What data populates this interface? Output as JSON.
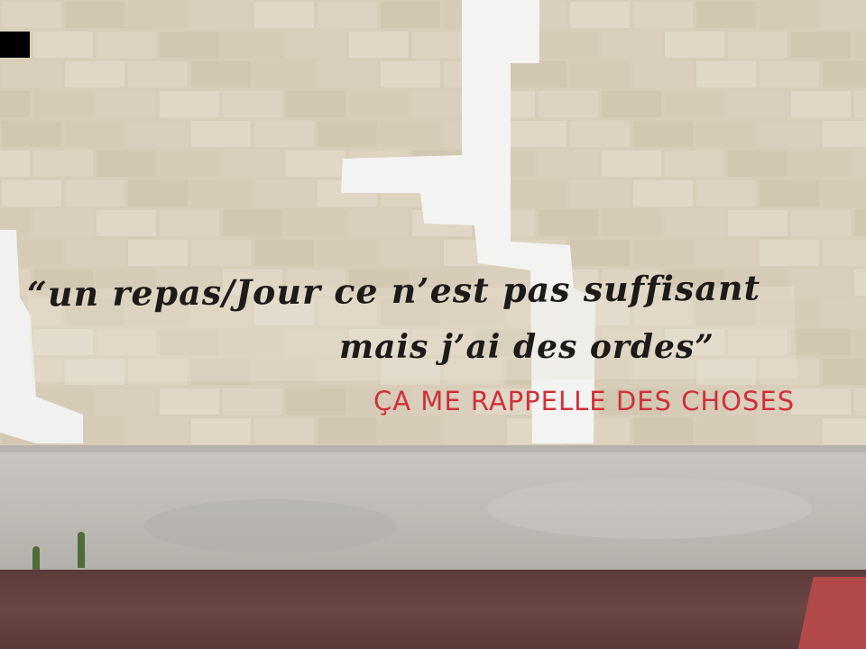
{
  "graffiti": {
    "line1": "“un repas/Jour ce n’est pas suffisant",
    "line2": "mais j’ai des ordes”",
    "line3": "ÇA ME RAPPELLE DES CHOSES"
  },
  "colors": {
    "wall": "#d8cdb9",
    "white_paint": "#f3f3f1",
    "black_paint": "#1d1b1a",
    "red_paint": "#d0303a",
    "concrete_base": "#c3c0bb",
    "ground": "#5f3f3e"
  }
}
